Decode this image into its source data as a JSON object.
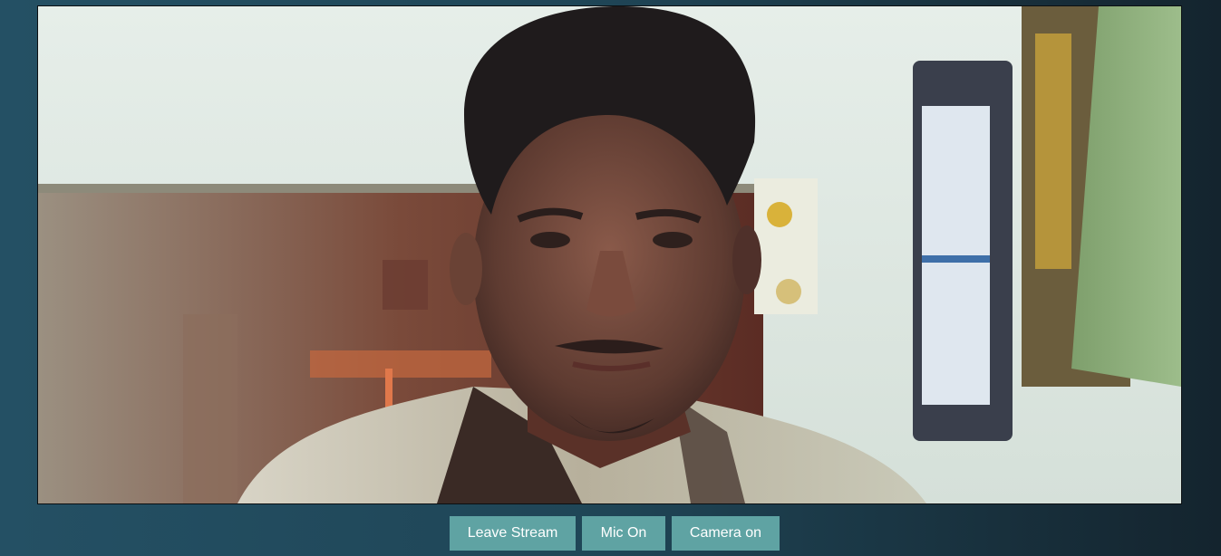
{
  "controls": {
    "leave_label": "Leave Stream",
    "mic_label": "Mic On",
    "camera_label": "Camera on"
  },
  "colors": {
    "background_left": "#245064",
    "background_right": "#14242e",
    "button_bg": "#5fa3a3",
    "button_text": "#ffffff"
  }
}
